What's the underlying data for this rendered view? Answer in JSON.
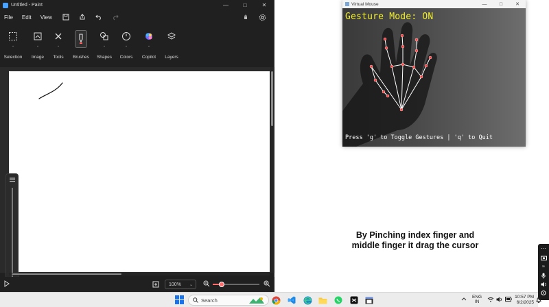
{
  "paint": {
    "title": "Untitled - Paint",
    "menu": [
      "File",
      "Edit",
      "View"
    ],
    "ribbon": {
      "selection": "Selection",
      "image": "Image",
      "tools": "Tools",
      "brushes": "Brushes",
      "shapes": "Shapes",
      "colors": "Colors",
      "copilot": "Copilot",
      "layers": "Layers"
    },
    "status": {
      "zoom": "100%"
    },
    "colors": {
      "accent": "#ff5c5c",
      "window_bg": "#202020",
      "canvas": "#ffffff"
    }
  },
  "virtual_mouse": {
    "title": "Virtual Mouse",
    "gesture_status": "Gesture Mode: ON",
    "help_text": "Press 'g' to Toggle Gestures | 'q' to Quit",
    "colors": {
      "status_text": "#f2ef2d",
      "landmark": "#ff3b3b",
      "skeleton": "#ffffff"
    }
  },
  "caption": {
    "line1": "By Pinching index finger and",
    "line2": "middle finger it drag the cursor"
  },
  "taskbar": {
    "search_placeholder": "Search",
    "language_line1": "ENG",
    "language_line2": "IN",
    "time": "10:57 PM",
    "date": "6/2/2025",
    "apps": [
      "chrome-icon",
      "vscode-icon",
      "edge-icon",
      "file-explorer-icon",
      "whatsapp-icon",
      "capcut-icon",
      "terminal-icon"
    ]
  }
}
